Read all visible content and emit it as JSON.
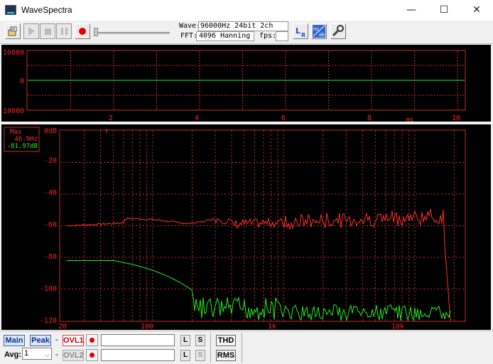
{
  "window": {
    "title": "WaveSpectra",
    "minimize": "—",
    "maximize": "☐",
    "close": "✕"
  },
  "toolbar": {
    "wave_label": "Wave:",
    "wave_value": "96000Hz 24bit 2ch",
    "fft_label": "FFT:",
    "fft_value": "4096 Hanning",
    "fps_label": "fps:",
    "fps_value": ""
  },
  "waveform": {
    "y_ticks": [
      "10000",
      "0",
      "-10000"
    ],
    "x_ticks": [
      "2",
      "4",
      "6",
      "8",
      "10"
    ],
    "x_unit": "ms"
  },
  "spectrum": {
    "y_ticks": [
      "0dB",
      "-20",
      "-40",
      "-60",
      "-80",
      "-100",
      "-120"
    ],
    "x_ticks": [
      "20",
      "100",
      "1k",
      "10k"
    ],
    "marker": {
      "label": "Max",
      "freq": "46.9Hz",
      "level": "-81.97dB"
    }
  },
  "bottom": {
    "main_button": "Main",
    "peak_button": "Peak",
    "dash1": "-",
    "dash2": "-",
    "ovl1_button": "OVL1",
    "ovl2_button": "OVL2",
    "l_button": "L",
    "s_button": "S",
    "thd_button": "THD",
    "rms_button": "RMS",
    "avg_label": "Avg:",
    "avg_value": "1",
    "ovl1_name": "",
    "ovl2_name": ""
  },
  "colors": {
    "grid": "#c03030",
    "trace_red": "#ff3030",
    "trace_green": "#22ee22",
    "axis_text": "#ff2020"
  }
}
